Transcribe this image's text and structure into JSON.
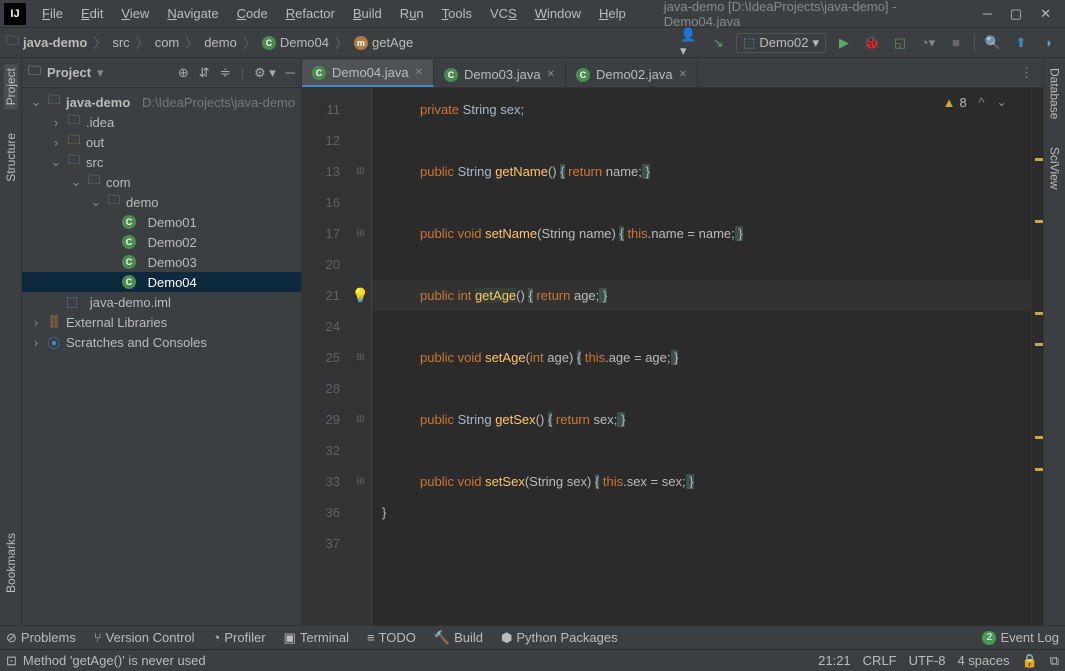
{
  "titlebar": {
    "appicon": "IJ",
    "title": "java-demo [D:\\IdeaProjects\\java-demo] - Demo04.java"
  },
  "menu": [
    "File",
    "Edit",
    "View",
    "Navigate",
    "Code",
    "Refactor",
    "Build",
    "Run",
    "Tools",
    "VCS",
    "Window",
    "Help"
  ],
  "breadcrumbs": {
    "project": "java-demo",
    "src": "src",
    "com": "com",
    "demo": "demo",
    "class": "Demo04",
    "method": "getAge"
  },
  "runconfig": {
    "label": "Demo02"
  },
  "sidepanels": {
    "project": "Project",
    "structure": "Structure",
    "bookmarks": "Bookmarks",
    "database": "Database",
    "sciview": "SciView"
  },
  "projectpanel": {
    "title": "Project"
  },
  "tree": {
    "root": "java-demo",
    "rootpath": "D:\\IdeaProjects\\java-demo",
    "idea": ".idea",
    "out": "out",
    "src": "src",
    "compkg": "com",
    "demopkg": "demo",
    "d1": "Demo01",
    "d2": "Demo02",
    "d3": "Demo03",
    "d4": "Demo04",
    "iml": "java-demo.iml",
    "extlib": "External Libraries",
    "scratch": "Scratches and Consoles"
  },
  "tabs": {
    "t1": "Demo04.java",
    "t2": "Demo03.java",
    "t3": "Demo02.java"
  },
  "editor": {
    "linenumbers": [
      "11",
      "12",
      "13",
      "16",
      "17",
      "20",
      "21",
      "24",
      "25",
      "28",
      "29",
      "32",
      "33",
      "36",
      "37"
    ],
    "problems_count": "8"
  },
  "code": {
    "l11a": "private",
    "l11b": "String sex;",
    "l13a": "public",
    "l13b": "String",
    "l13c": "getName",
    "l13d": "() ",
    "l13e": "{",
    "l13f": " return",
    "l13g": " name;",
    "l13h": " }",
    "l17a": "public",
    "l17b": "void",
    "l17c": "setName",
    "l17d": "(String name) ",
    "l17e": "{",
    "l17f": " this",
    "l17g": ".name = name;",
    "l17h": " }",
    "l21a": "public",
    "l21b": "int",
    "l21c": "getAge",
    "l21d": "() ",
    "l21e": "{",
    "l21f": " return",
    "l21g": " age;",
    "l21h": " }",
    "l25a": "public",
    "l25b": "void",
    "l25c": "setAge",
    "l25d": "(",
    "l25e": "int",
    "l25f": " age) ",
    "l25g": "{",
    "l25h": " this",
    "l25i": ".age = age;",
    "l25j": " }",
    "l29a": "public",
    "l29b": "String",
    "l29c": "getSex",
    "l29d": "() ",
    "l29e": "{",
    "l29f": " return",
    "l29g": " sex;",
    "l29h": " }",
    "l33a": "public",
    "l33b": "void",
    "l33c": "setSex",
    "l33d": "(String sex) ",
    "l33e": "{",
    "l33f": " this",
    "l33g": ".sex = sex;",
    "l33h": " }",
    "l36": "}"
  },
  "bottomtools": {
    "problems": "Problems",
    "vcs": "Version Control",
    "profiler": "Profiler",
    "terminal": "Terminal",
    "todo": "TODO",
    "build": "Build",
    "python": "Python Packages",
    "eventlog": "Event Log",
    "eventcount": "2"
  },
  "status": {
    "msg": "Method 'getAge()' is never used",
    "pos": "21:21",
    "lineend": "CRLF",
    "enc": "UTF-8",
    "indent": "4 spaces"
  }
}
